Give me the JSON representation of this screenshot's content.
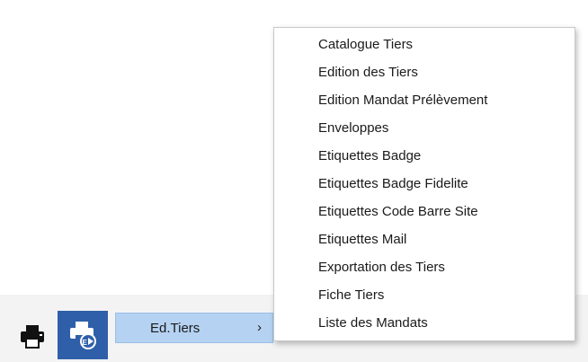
{
  "toolbar": {
    "print_icon": "printer-icon",
    "print_edit_icon": "printer-edit-icon",
    "accent": "#2f5fa8"
  },
  "submenu": {
    "label": "Ed.Tiers",
    "arrow": "›",
    "highlight": "#b5d2f2"
  },
  "menu": {
    "items": [
      "Catalogue Tiers",
      "Edition des Tiers",
      "Edition Mandat Prélèvement",
      "Enveloppes",
      "Etiquettes Badge",
      "Etiquettes Badge Fidelite",
      "Etiquettes Code Barre Site",
      "Etiquettes Mail",
      "Exportation des Tiers",
      "Fiche Tiers",
      "Liste des Mandats"
    ]
  }
}
